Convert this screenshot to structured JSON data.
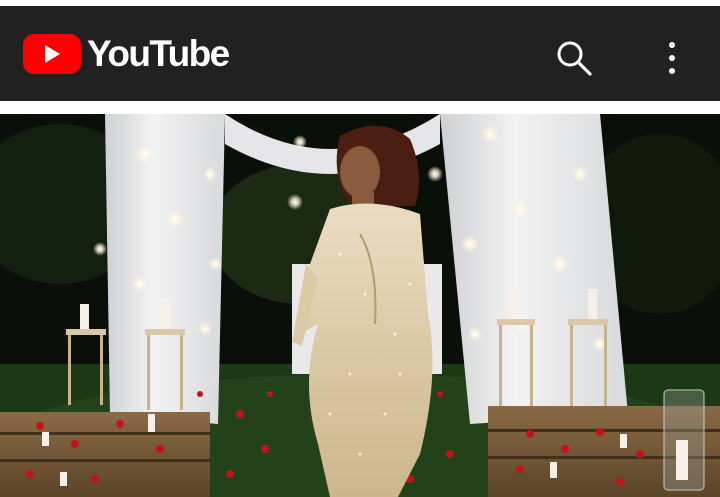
{
  "app": {
    "name": "YouTube",
    "brand_color": "#ff0000",
    "header_background": "#212121"
  },
  "header": {
    "logo_icon": "play-icon",
    "search_icon": "search-icon",
    "more_icon": "more-vertical-icon"
  },
  "video": {
    "state": "paused-frame",
    "thumbnail_subject": "video-frame"
  }
}
